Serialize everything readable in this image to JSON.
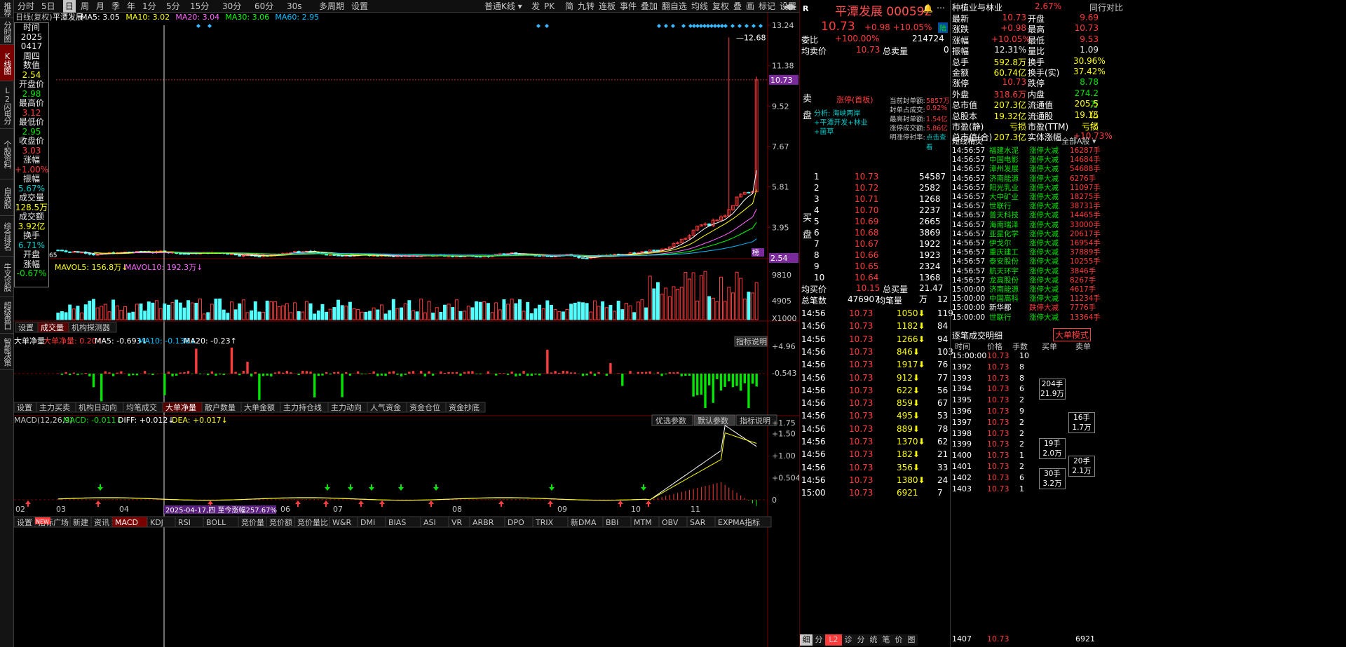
{
  "sidebar_tabs": [
    {
      "label": "推荐",
      "active": false
    },
    {
      "label": "分时图",
      "active": false
    },
    {
      "label": "K线图",
      "active": true
    },
    {
      "label": "L2闪电分时",
      "active": false
    },
    {
      "label": "个股资料",
      "active": false
    },
    {
      "label": "自选股",
      "active": false
    },
    {
      "label": "综合排名",
      "active": false
    },
    {
      "label": "牛叉诊股",
      "active": false
    },
    {
      "label": "超级盘口",
      "active": false
    },
    {
      "label": "智能决策",
      "active": false
    }
  ],
  "period_bar": [
    "分时",
    "5日",
    "日",
    "周",
    "月",
    "季",
    "年",
    "1分",
    "5分",
    "15分",
    "30分",
    "60分",
    "30s",
    "多周期",
    "设置"
  ],
  "period_selected": "日",
  "kline_type": "普通K线",
  "toolbar_right": [
    "发",
    "PK",
    "简",
    "九转",
    "连板",
    "事件",
    "叠加",
    "翻自选",
    "均线",
    "复权",
    "叠",
    "画",
    "标记",
    "设置"
  ],
  "kchart": {
    "title": "日线(复权)",
    "name": "平潭发展",
    "ma": [
      {
        "label": "MA5: 3.05",
        "color": "#ffffff"
      },
      {
        "label": "MA10: 3.02",
        "color": "#ffff00"
      },
      {
        "label": "MA20: 3.04",
        "color": "#ff66ff"
      },
      {
        "label": "MA30: 3.06",
        "color": "#00ff00"
      },
      {
        "label": "MA60: 2.95",
        "color": "#00bfff"
      }
    ],
    "yticks": [
      "13.24",
      "11.38",
      "9.52",
      "7.67",
      "5.81",
      "3.95"
    ],
    "current_price": "10.73",
    "low_price": "2.54",
    "high_mark": "12.68",
    "low_mark": "65",
    "flag": "榜"
  },
  "vol": {
    "title": "万↑",
    "mavol5": "MAVOL5: 156.8万↓",
    "mavol10": "MAVOL10: 192.3万↓",
    "yticks": [
      "9810",
      "4905",
      "X1000"
    ],
    "tabs": [
      "设置",
      "成交量",
      "机构探测器"
    ],
    "tab_active": "成交量"
  },
  "dadan": {
    "title": "大单净量",
    "val": "大单净量: 0.20↑",
    "ma5": "MA5: -0.693↓",
    "ma10": "MA10: -0.136↓",
    "ma20": "MA20: -0.23↑",
    "yticks": [
      "+4.96",
      "-0.543"
    ],
    "help": "指标说明",
    "tabs": [
      "设置",
      "主力买卖",
      "机构日动向",
      "均笔成交",
      "大单净量",
      "散户数量",
      "大单金额",
      "主力持仓线",
      "主力动向",
      "人气资金",
      "资金仓位",
      "资金抄底"
    ],
    "tab_active": "大单净量"
  },
  "macd": {
    "title": "MACD(12,26,9)",
    "macd": "MACD: -0.011↓",
    "diff": "DIFF: +0.012↓",
    "dea": "DEA: +0.017↓",
    "yticks": [
      "+1.75",
      "+1.50",
      "+1.00",
      "+0.504",
      "0"
    ],
    "btns": [
      "优选参数",
      "默认参数",
      "指标说明"
    ],
    "xdates": [
      "02",
      "03",
      "04",
      "05",
      "06",
      "07",
      "08",
      "09",
      "10",
      "11"
    ],
    "note": "2025-04-17,四 至今涨幅257.67%"
  },
  "bottom_tabs": [
    "设置",
    "指标广场",
    "新建",
    "资讯",
    "MACD",
    "KDJ",
    "RSI",
    "BOLL",
    "竞价量",
    "竞价额",
    "竞价量比",
    "W&R",
    "DMI",
    "BIAS",
    "ASI",
    "VR",
    "ARBR",
    "DPO",
    "TRIX",
    "新DMA",
    "BBI",
    "MTM",
    "OBV",
    "SAR",
    "EXPMA指标"
  ],
  "bottom_active": "MACD",
  "bottom_new": "NEW",
  "datawin": [
    {
      "t": "时间",
      "c": "wht"
    },
    {
      "t": "2025",
      "c": "wht"
    },
    {
      "t": "0417",
      "c": "wht"
    },
    {
      "t": "周四",
      "c": "wht"
    },
    {
      "t": "数值",
      "c": "wht"
    },
    {
      "t": "2.54",
      "c": "yel"
    },
    {
      "t": "开盘价",
      "c": "wht"
    },
    {
      "t": "2.98",
      "c": "grn"
    },
    {
      "t": "最高价",
      "c": "wht"
    },
    {
      "t": "3.12",
      "c": "red"
    },
    {
      "t": "最低价",
      "c": "wht"
    },
    {
      "t": "2.95",
      "c": "grn"
    },
    {
      "t": "收盘价",
      "c": "wht"
    },
    {
      "t": "3.03",
      "c": "red"
    },
    {
      "t": "涨幅",
      "c": "wht"
    },
    {
      "t": "+1.00%",
      "c": "red"
    },
    {
      "t": "振幅",
      "c": "wht"
    },
    {
      "t": "5.67%",
      "c": "cyn"
    },
    {
      "t": "成交量",
      "c": "wht"
    },
    {
      "t": "128.5万",
      "c": "yel"
    },
    {
      "t": "成交额",
      "c": "wht"
    },
    {
      "t": "3.92亿",
      "c": "yel"
    },
    {
      "t": "换手",
      "c": "wht"
    },
    {
      "t": "6.71%",
      "c": "cyn"
    },
    {
      "t": "开盘",
      "c": "wht"
    },
    {
      "t": "涨幅",
      "c": "wht"
    },
    {
      "t": "-0.67%",
      "c": "grn"
    }
  ],
  "quote": {
    "stock_name": "平潭发展",
    "stock_code": "000592",
    "price": "10.73",
    "chg": "+0.98",
    "pct": "+10.05%",
    "tag": "陆",
    "r": "R",
    "weibi_label": "委比",
    "weibi": "+100.00%",
    "weibi_val": "214724",
    "junmai_label": "均卖价",
    "junmai": "10.73",
    "zongmai_label": "总卖量",
    "zongmai": "0",
    "sell_label": "卖盘",
    "limit_title": "涨停(首板)",
    "analysis": "分析: 海峡两岸+平潭开发+林业+菌草",
    "stats": [
      [
        "当前封单额",
        "5857万"
      ],
      [
        "封单占成交",
        "0.92%"
      ],
      [
        "最高封单额",
        "1.54亿"
      ],
      [
        "涨停成交额",
        "5.86亿"
      ],
      [
        "明涨停封率",
        "点击查看"
      ]
    ],
    "buy_label": "买盘",
    "bids": [
      [
        "1",
        "10.73",
        "54587"
      ],
      [
        "2",
        "10.72",
        "2582"
      ],
      [
        "3",
        "10.71",
        "1268"
      ],
      [
        "4",
        "10.70",
        "2237"
      ],
      [
        "5",
        "10.69",
        "2665"
      ],
      [
        "6",
        "10.68",
        "3869"
      ],
      [
        "7",
        "10.67",
        "1922"
      ],
      [
        "8",
        "10.66",
        "1923"
      ],
      [
        "9",
        "10.65",
        "2324"
      ],
      [
        "10",
        "10.64",
        "1368"
      ]
    ],
    "junbuy_label": "均买价",
    "junbuy": "10.15",
    "zongbuy_label": "总买量",
    "zongbuy": "21.47万",
    "zongbishu_label": "总笔数",
    "zongbishu": "476907",
    "junbi_label": "均笔量",
    "junbi": "12",
    "ticks": [
      [
        "14:56",
        "10.73",
        "1050",
        "119"
      ],
      [
        "14:56",
        "10.73",
        "1182",
        "84"
      ],
      [
        "14:56",
        "10.73",
        "1266",
        "94"
      ],
      [
        "14:56",
        "10.73",
        "846",
        "103"
      ],
      [
        "14:56",
        "10.73",
        "1917",
        "76"
      ],
      [
        "14:56",
        "10.73",
        "912",
        "77"
      ],
      [
        "14:56",
        "10.73",
        "622",
        "56"
      ],
      [
        "14:56",
        "10.73",
        "859",
        "67"
      ],
      [
        "14:56",
        "10.73",
        "495",
        "53"
      ],
      [
        "14:56",
        "10.73",
        "889",
        "78"
      ],
      [
        "14:56",
        "10.73",
        "1370",
        "62"
      ],
      [
        "14:56",
        "10.73",
        "182",
        "21"
      ],
      [
        "14:56",
        "10.73",
        "356",
        "33"
      ],
      [
        "14:56",
        "10.73",
        "1380",
        "24"
      ],
      [
        "15:00",
        "10.73",
        "6921",
        "7"
      ]
    ],
    "tabs": [
      "细",
      "分",
      "L2",
      "诊",
      "分",
      "统",
      "笔",
      "价",
      "图"
    ]
  },
  "right": {
    "sector": "种植业与林业",
    "sector_pct": "2.67%",
    "peer": "同行对比",
    "stats": [
      [
        "最新",
        "10.73",
        "red",
        "开盘",
        "9.69",
        "red"
      ],
      [
        "涨跌",
        "+0.98",
        "red",
        "最高",
        "10.73",
        "red"
      ],
      [
        "涨幅",
        "+10.05%",
        "red",
        "最低",
        "9.53",
        "red"
      ],
      [
        "振幅",
        "12.31%",
        "wht",
        "量比",
        "1.09",
        "wht"
      ],
      [
        "总手",
        "592.8万",
        "yel",
        "换手",
        "30.96%",
        "yel"
      ],
      [
        "金额",
        "60.74亿",
        "yel",
        "换手(实)",
        "37.42%",
        "yel"
      ],
      [
        "涨停",
        "10.73",
        "red",
        "跌停",
        "8.78",
        "grn"
      ],
      [
        "外盘",
        "318.6万",
        "red",
        "内盘",
        "274.2万",
        "grn"
      ],
      [
        "总市值",
        "207.3亿",
        "yel",
        "流通值",
        "205.5亿",
        "yel"
      ],
      [
        "总股本",
        "19.32亿",
        "yel",
        "流通股",
        "19.15亿",
        "yel"
      ],
      [
        "市盈(静)",
        "亏损",
        "yel",
        "市盈(TTM)",
        "亏损",
        "yel"
      ],
      [
        "总市值(合)",
        "207.3亿",
        "yel",
        "实体涨幅",
        "+10.73%",
        "red"
      ]
    ],
    "short_title": "短线精灵",
    "short_filter": "全部A股",
    "shorts": [
      [
        "14:56:57",
        "福建水泥",
        "涨停大减",
        "16287手"
      ],
      [
        "14:56:57",
        "中国电影",
        "涨停大减",
        "14684手"
      ],
      [
        "14:56:57",
        "漳州发展",
        "涨停大减",
        "54688手"
      ],
      [
        "14:56:57",
        "济南能源",
        "涨停大减",
        "6276手"
      ],
      [
        "14:56:57",
        "阳光乳业",
        "涨停大减",
        "11097手"
      ],
      [
        "14:56:57",
        "大中矿业",
        "涨停大减",
        "18275手"
      ],
      [
        "14:56:57",
        "世联行",
        "涨停大减",
        "38731手"
      ],
      [
        "14:56:57",
        "普天科技",
        "涨停大减",
        "14465手"
      ],
      [
        "14:56:57",
        "海南瑞泽",
        "涨停大减",
        "33000手"
      ],
      [
        "14:56:57",
        "亚星化学",
        "涨停大减",
        "20617手"
      ],
      [
        "14:56:57",
        "伊戈尔",
        "涨停大减",
        "16954手"
      ],
      [
        "14:56:57",
        "重庆建工",
        "涨停大减",
        "37889手"
      ],
      [
        "14:56:57",
        "泰安股份",
        "涨停大减",
        "10255手"
      ],
      [
        "14:56:57",
        "航天环宇",
        "涨停大减",
        "3846手"
      ],
      [
        "14:56:57",
        "龙高股份",
        "涨停大减",
        "8267手"
      ],
      [
        "15:00:00",
        "济南能源",
        "涨停大减",
        "4617手"
      ],
      [
        "15:00:00",
        "中国高科",
        "涨停大减",
        "11234手"
      ],
      [
        "15:00:00",
        "新华都",
        "跌停大减",
        "7776手"
      ],
      [
        "15:00:00",
        "世联行",
        "涨停大减",
        "13364手"
      ]
    ],
    "detail_title": "逐笔成交明细",
    "detail_btn": "大单模式",
    "detail_head": [
      "时间",
      "价格",
      "手数",
      "买单",
      "卖单"
    ],
    "details": [
      [
        "15:00:00",
        "10.73",
        "10"
      ],
      [
        "1392",
        "10.73",
        "8"
      ],
      [
        "1393",
        "10.73",
        "8"
      ],
      [
        "1394",
        "10.73",
        "6"
      ],
      [
        "1395",
        "10.73",
        "2"
      ],
      [
        "1396",
        "10.73",
        "9"
      ],
      [
        "1397",
        "10.73",
        "2"
      ],
      [
        "1398",
        "10.73",
        "2"
      ],
      [
        "1399",
        "10.73",
        "2"
      ],
      [
        "1400",
        "10.73",
        "1"
      ],
      [
        "1401",
        "10.73",
        "2"
      ],
      [
        "1402",
        "10.73",
        "6"
      ],
      [
        "1403",
        "10.73",
        "1"
      ]
    ],
    "buy_orders": [
      [
        "204手",
        "21.9万"
      ],
      [
        "19手",
        "2.0万"
      ],
      [
        "30手",
        "3.2万"
      ]
    ],
    "sell_orders": [
      [
        "16手",
        "1.7万"
      ],
      [
        "20手",
        "2.1万"
      ]
    ],
    "last_tick": [
      "1407",
      "10.73"
    ],
    "last_num": "6921"
  }
}
